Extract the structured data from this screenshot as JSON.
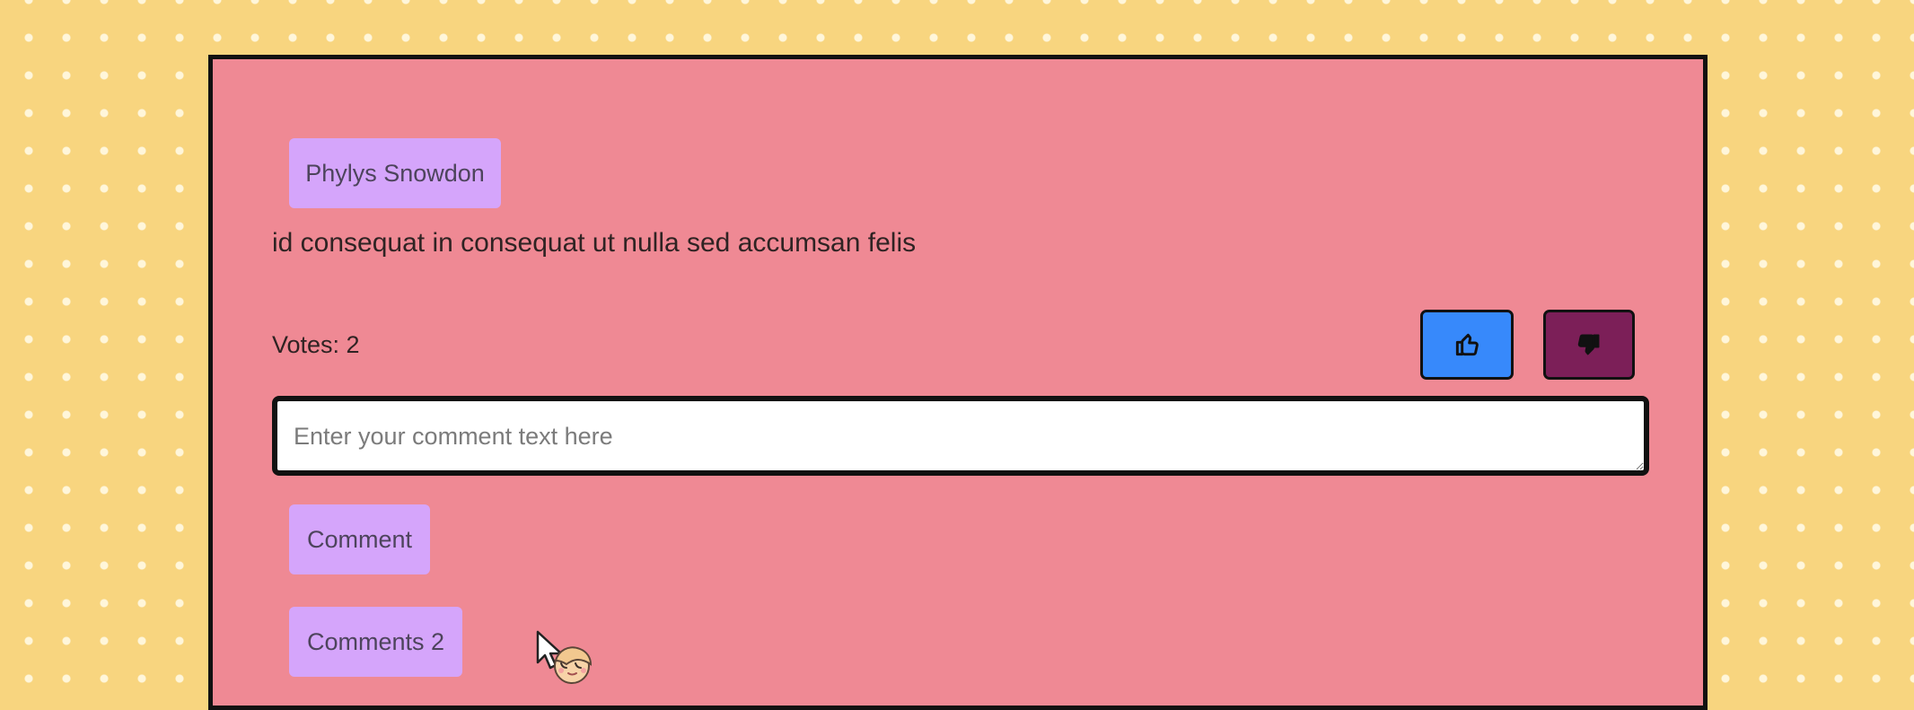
{
  "post": {
    "author": "Phylys Snowdon",
    "text": "id consequat in consequat ut nulla sed accumsan felis",
    "votes_label": "Votes: 2"
  },
  "vote_buttons": {
    "upvote_icon": "thumbs-up-icon",
    "downvote_icon": "thumbs-down-icon"
  },
  "comment_form": {
    "placeholder": "Enter your comment text here",
    "value": "",
    "submit_label": "Comment"
  },
  "comments_toggle": {
    "label": "Comments 2"
  },
  "cursor": {
    "icon": "mascot-cursor-icon"
  },
  "colors": {
    "background": "#f8d57f",
    "card": "#ef8994",
    "accent": "#d5a5fb",
    "upvote": "#3789fb",
    "downvote": "#7c1f58"
  }
}
